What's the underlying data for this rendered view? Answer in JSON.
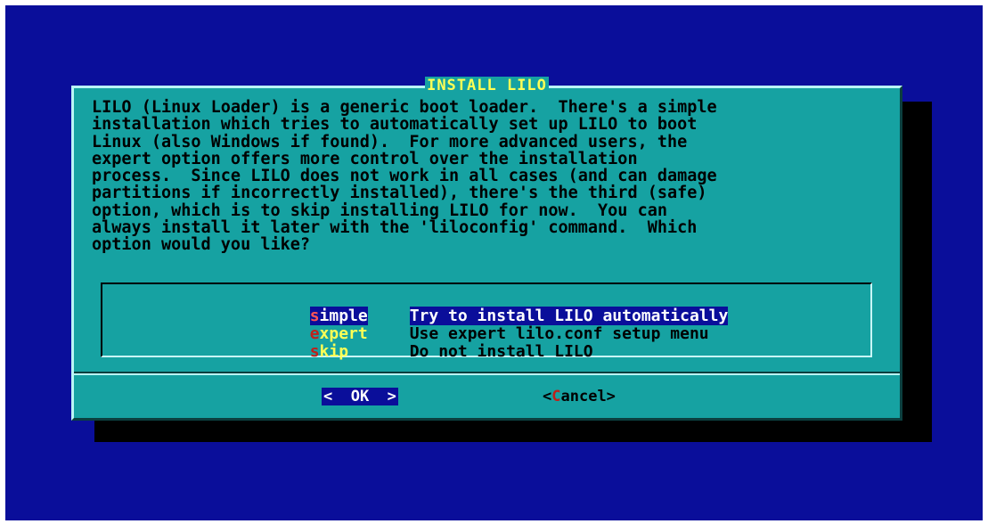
{
  "dialog": {
    "title": "INSTALL LILO",
    "message": "LILO (Linux Loader) is a generic boot loader.  There's a simple\ninstallation which tries to automatically set up LILO to boot\nLinux (also Windows if found).  For more advanced users, the\nexpert option offers more control over the installation\nprocess.  Since LILO does not work in all cases (and can damage\npartitions if incorrectly installed), there's the third (safe)\noption, which is to skip installing LILO for now.  You can\nalways install it later with the 'liloconfig' command.  Which\noption would you like?"
  },
  "menu": {
    "items": [
      {
        "tag_hot": "s",
        "tag_rest": "imple",
        "description": "Try to install LILO automatically",
        "selected": true
      },
      {
        "tag_hot": "e",
        "tag_rest": "xpert",
        "description": "Use expert lilo.conf setup menu",
        "selected": false
      },
      {
        "tag_hot": "s",
        "tag_rest": "kip",
        "description": "Do not install LILO",
        "selected": false
      }
    ]
  },
  "buttons": {
    "ok_left": "<  ",
    "ok_hot": "O",
    "ok_rest": "K  >",
    "cancel_left": "<",
    "cancel_hot": "C",
    "cancel_rest": "ancel>"
  },
  "colors": {
    "screen_bg": "#0a0e9a",
    "dialog_bg": "#16a2a2",
    "title_fg": "#ffff55",
    "hotkey_fg": "#c0201a"
  }
}
